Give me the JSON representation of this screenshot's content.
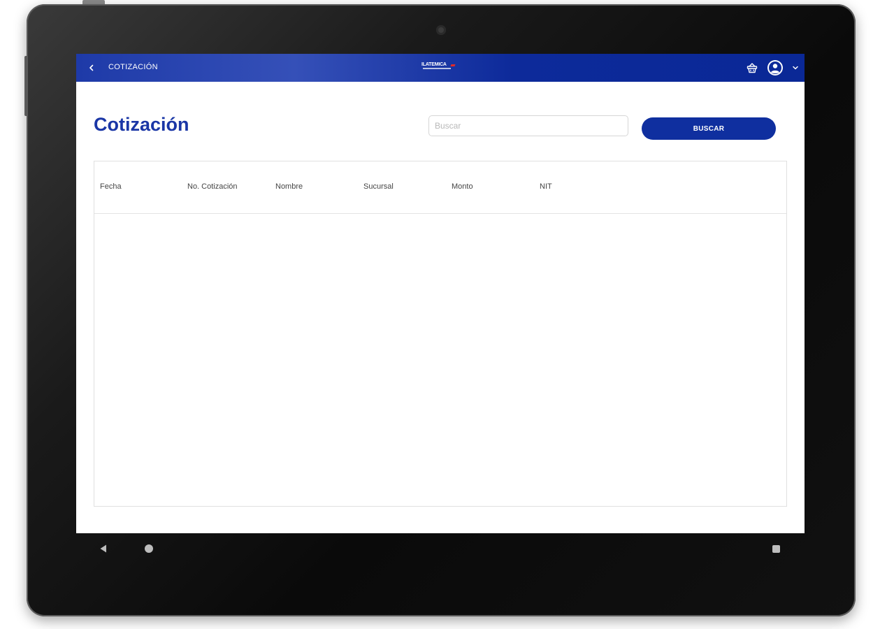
{
  "appbar": {
    "title": "COTIZACIÓN",
    "logo_text": "ILATEMICA"
  },
  "page": {
    "title": "Cotización"
  },
  "search": {
    "placeholder": "Buscar",
    "value": "",
    "button_label": "BUSCAR"
  },
  "table": {
    "columns": [
      "Fecha",
      "No. Cotización",
      "Nombre",
      "Sucursal",
      "Monto",
      "NIT"
    ],
    "rows": []
  },
  "icons": {
    "back": "chevron-left-icon",
    "cart": "basket-icon",
    "account": "account-circle-icon",
    "dropdown": "chevron-down-icon"
  },
  "colors": {
    "brand": "#0f2f9f",
    "title": "#1a36a6"
  }
}
